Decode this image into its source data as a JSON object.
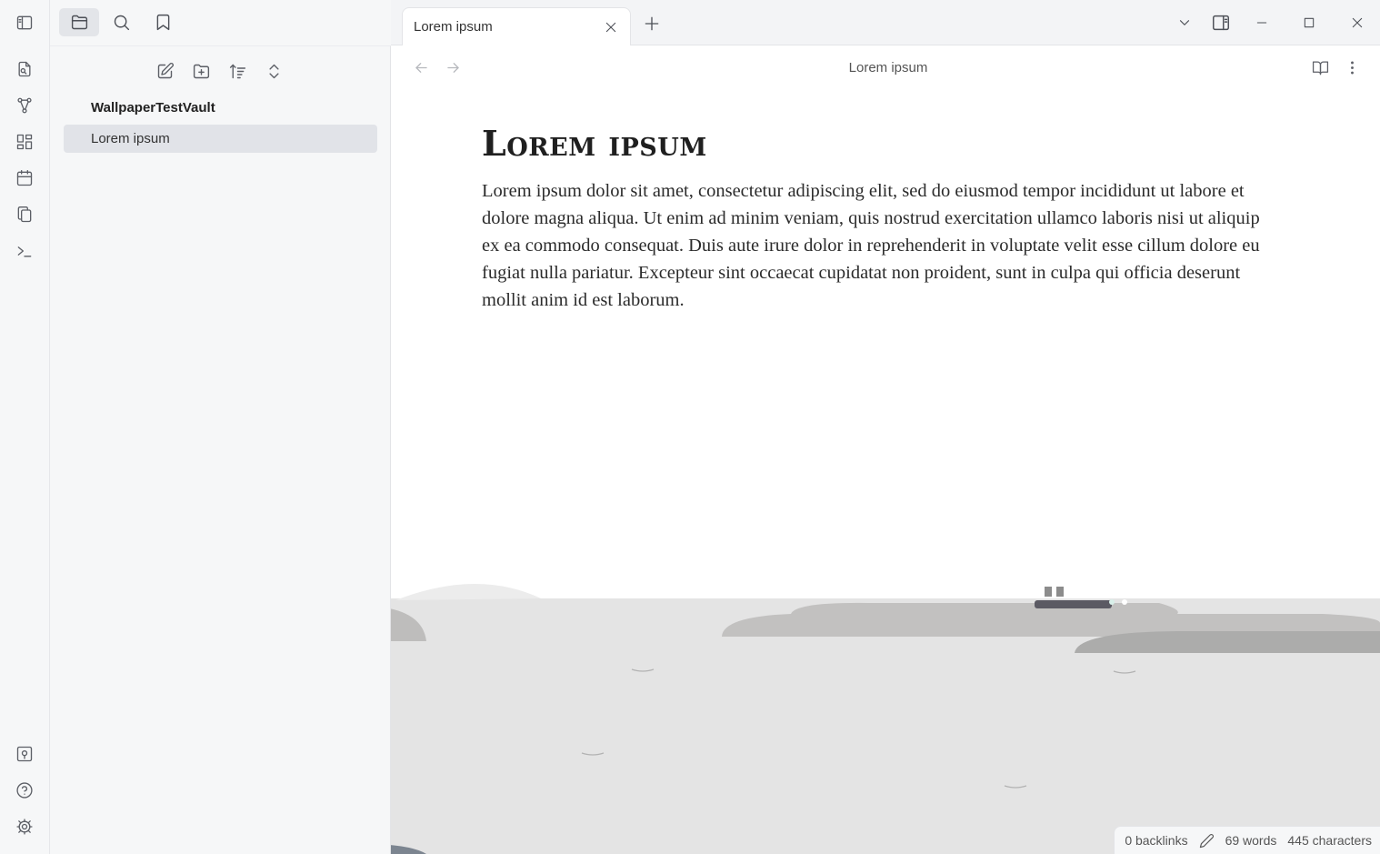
{
  "sidebar": {
    "vault_name": "WallpaperTestVault",
    "files": [
      {
        "label": "Lorem ipsum",
        "selected": true
      }
    ]
  },
  "ribbon": {
    "icons": [
      "sidebar-toggle-icon",
      "open-quick-switcher-icon",
      "graph-view-icon",
      "canvas-icon",
      "daily-note-icon",
      "templates-icon",
      "command-palette-icon",
      "vault-switcher-icon",
      "help-icon",
      "settings-icon"
    ]
  },
  "tabs": [
    {
      "label": "Lorem ipsum",
      "active": true
    }
  ],
  "view": {
    "title": "Lorem ipsum"
  },
  "note": {
    "title": "Lorem ipsum",
    "body": "Lorem ipsum dolor sit amet, consectetur adipiscing elit, sed do eiusmod tempor incididunt ut labore et dolore magna aliqua. Ut enim ad minim veniam, quis nostrud exercitation ullamco laboris nisi ut aliquip ex ea commodo consequat. Duis aute irure dolor in reprehenderit in voluptate velit esse cillum dolore eu fugiat nulla pariatur. Excepteur sint occaecat cupidatat non proident, sunt in culpa qui officia deserunt mollit anim id est laborum."
  },
  "status": {
    "backlinks": "0 backlinks",
    "words": "69 words",
    "characters": "445 characters"
  },
  "colors": {
    "accent_selected": "#e1e3e8",
    "sidebar_bg": "#f6f7f8",
    "sea": "#e4e4e4",
    "island": "#c3c3c3"
  }
}
